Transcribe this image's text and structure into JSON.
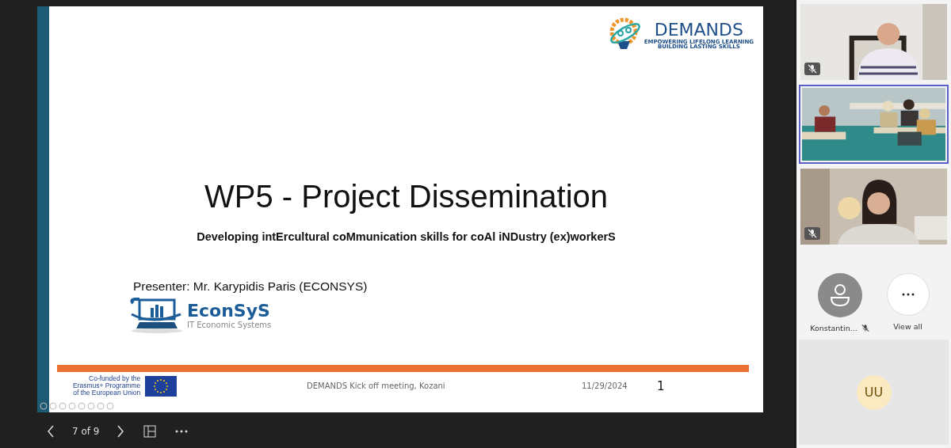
{
  "slide": {
    "logo": {
      "name": "DEMANDS",
      "tagline_1": "EMPOWERING LIFELONG LEARNING",
      "tagline_2": "BUILDING LASTING SKILLS"
    },
    "title": "WP5 - Project Dissemination",
    "subtitle": "Developing intErcultural coMmunication skills for coAl iNDustry (ex)workerS",
    "presenter": "Presenter: Mr. Karypidis Paris (ECONSYS)",
    "partner_logo": {
      "name": "EconSyS",
      "tagline": "IT Economic Systems"
    },
    "funding_note": "Co-funded by the\nErasmus+ Programme\nof the European Union",
    "footer": "DEMANDS Kick off meeting, Kozani",
    "date": "11/29/2024",
    "page_number": "1"
  },
  "navigation": {
    "page_indicator": "7 of 9"
  },
  "video_tiles": [
    {
      "kind": "picture",
      "muted": true,
      "selected": false
    },
    {
      "kind": "picture",
      "muted": false,
      "selected": true
    },
    {
      "kind": "picture",
      "muted": true,
      "selected": false
    }
  ],
  "participants": [
    {
      "kind": "avatar",
      "name": "Konstantin...",
      "muted": true
    },
    {
      "kind": "more",
      "name": "View all",
      "muted": false
    }
  ],
  "self_tile": {
    "initials": "UU"
  }
}
